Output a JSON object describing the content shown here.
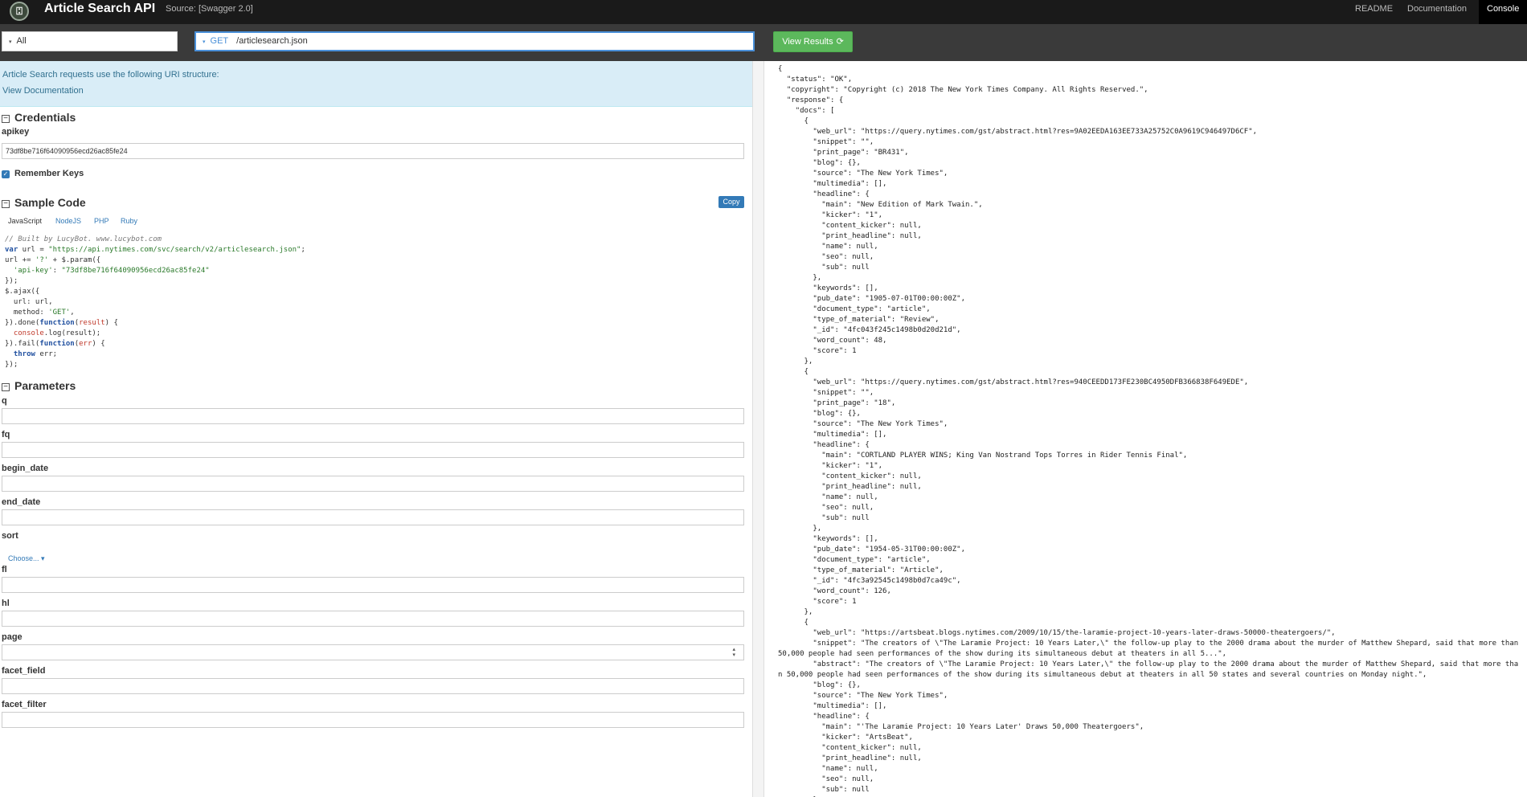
{
  "app": {
    "logo_glyph": "⍠",
    "title": "Article Search API",
    "source": "Source: [Swagger 2.0]"
  },
  "nav": {
    "readme": "README",
    "documentation": "Documentation",
    "console": "Console"
  },
  "toolbar": {
    "tag_filter": "All",
    "method": "GET",
    "path": "/articlesearch.json",
    "view_results": "View Results"
  },
  "info": {
    "text": "Article Search requests use the following URI structure:",
    "link": "View Documentation"
  },
  "credentials": {
    "title": "Credentials",
    "apikey_label": "apikey",
    "apikey_value": "73df8be716f64090956ecd26ac85fe24",
    "remember_label": "Remember Keys"
  },
  "sample_code": {
    "title": "Sample Code",
    "copy_label": "Copy",
    "tabs": [
      "JavaScript",
      "NodeJS",
      "PHP",
      "Ruby"
    ],
    "active_tab": "JavaScript",
    "lines": {
      "l1": "// Built by LucyBot. www.lucybot.com",
      "url_str": "\"https://api.nytimes.com/svc/search/v2/articlesearch.json\"",
      "apikey_key": "'api-key'",
      "apikey_val": "\"73df8be716f64090956ecd26ac85fe24\"",
      "get": "'GET'"
    }
  },
  "parameters": {
    "title": "Parameters",
    "q": "q",
    "fq": "fq",
    "begin_date": "begin_date",
    "end_date": "end_date",
    "sort": "sort",
    "sort_choose": "Choose...",
    "fl": "fl",
    "hl": "hl",
    "page": "page",
    "facet_field": "facet_field",
    "facet_filter": "facet_filter"
  },
  "response_json": "{\n  \"status\": \"OK\",\n  \"copyright\": \"Copyright (c) 2018 The New York Times Company. All Rights Reserved.\",\n  \"response\": {\n    \"docs\": [\n      {\n        \"web_url\": \"https://query.nytimes.com/gst/abstract.html?res=9A02EEDA163EE733A25752C0A9619C946497D6CF\",\n        \"snippet\": \"\",\n        \"print_page\": \"BR431\",\n        \"blog\": {},\n        \"source\": \"The New York Times\",\n        \"multimedia\": [],\n        \"headline\": {\n          \"main\": \"New Edition of Mark Twain.\",\n          \"kicker\": \"1\",\n          \"content_kicker\": null,\n          \"print_headline\": null,\n          \"name\": null,\n          \"seo\": null,\n          \"sub\": null\n        },\n        \"keywords\": [],\n        \"pub_date\": \"1905-07-01T00:00:00Z\",\n        \"document_type\": \"article\",\n        \"type_of_material\": \"Review\",\n        \"_id\": \"4fc043f245c1498b0d20d21d\",\n        \"word_count\": 48,\n        \"score\": 1\n      },\n      {\n        \"web_url\": \"https://query.nytimes.com/gst/abstract.html?res=940CEEDD173FE230BC4950DFB366838F649EDE\",\n        \"snippet\": \"\",\n        \"print_page\": \"18\",\n        \"blog\": {},\n        \"source\": \"The New York Times\",\n        \"multimedia\": [],\n        \"headline\": {\n          \"main\": \"CORTLAND PLAYER WINS; King Van Nostrand Tops Torres in Rider Tennis Final\",\n          \"kicker\": \"1\",\n          \"content_kicker\": null,\n          \"print_headline\": null,\n          \"name\": null,\n          \"seo\": null,\n          \"sub\": null\n        },\n        \"keywords\": [],\n        \"pub_date\": \"1954-05-31T00:00:00Z\",\n        \"document_type\": \"article\",\n        \"type_of_material\": \"Article\",\n        \"_id\": \"4fc3a92545c1498b0d7ca49c\",\n        \"word_count\": 126,\n        \"score\": 1\n      },\n      {\n        \"web_url\": \"https://artsbeat.blogs.nytimes.com/2009/10/15/the-laramie-project-10-years-later-draws-50000-theatergoers/\",\n        \"snippet\": \"The creators of \\\"The Laramie Project: 10 Years Later,\\\" the follow-up play to the 2000 drama about the murder of Matthew Shepard, said that more than 50,000 people had seen performances of the show during its simultaneous debut at theaters in all 5...\",\n        \"abstract\": \"The creators of \\\"The Laramie Project: 10 Years Later,\\\" the follow-up play to the 2000 drama about the murder of Matthew Shepard, said that more than 50,000 people had seen performances of the show during its simultaneous debut at theaters in all 50 states and several countries on Monday night.\",\n        \"blog\": {},\n        \"source\": \"The New York Times\",\n        \"multimedia\": [],\n        \"headline\": {\n          \"main\": \"'The Laramie Project: 10 Years Later' Draws 50,000 Theatergoers\",\n          \"kicker\": \"ArtsBeat\",\n          \"content_kicker\": null,\n          \"print_headline\": null,\n          \"name\": null,\n          \"seo\": null,\n          \"sub\": null\n        },"
}
